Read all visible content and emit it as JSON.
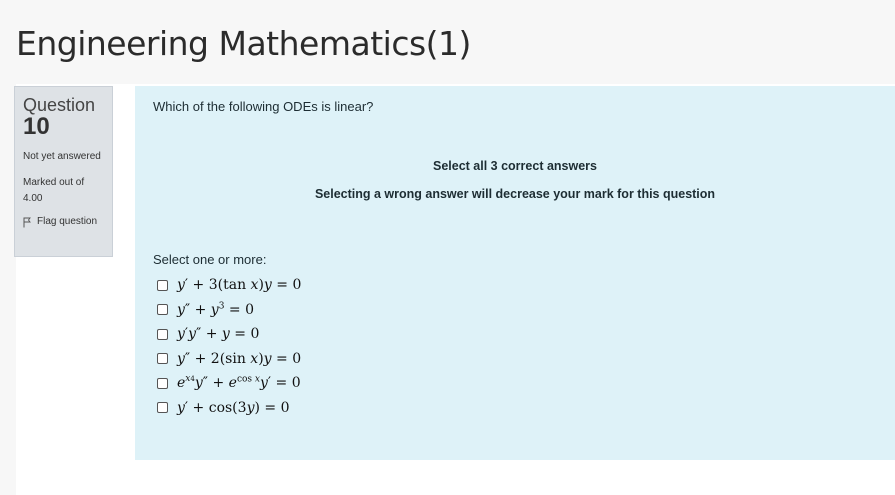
{
  "page": {
    "title": "Engineering Mathematics(1)"
  },
  "question_info": {
    "label": "Question",
    "number": "10",
    "state": "Not yet answered",
    "mark": "Marked out of 4.00",
    "flag_label": "Flag question"
  },
  "question": {
    "text": "Which of the following ODEs is linear?",
    "instruction_1": "Select all 3 correct answers",
    "instruction_2": "Selecting a wrong answer will decrease your mark for this question",
    "prompt": "Select one or more:",
    "options": [
      {
        "label": "y′ + 3(tan x)y = 0",
        "checked": false
      },
      {
        "label": "y″ + y³ = 0",
        "checked": false
      },
      {
        "label": "y′y″ + y = 0",
        "checked": false
      },
      {
        "label": "y″ + 2(sin x)y = 0",
        "checked": false
      },
      {
        "label": "e^(x⁴) y″ + e^(cos x) y′ = 0",
        "checked": false
      },
      {
        "label": "y′ + cos(3y) = 0",
        "checked": false
      }
    ]
  },
  "colors": {
    "info_bg": "#dee2e6",
    "formulation_bg": "#def2f8"
  }
}
